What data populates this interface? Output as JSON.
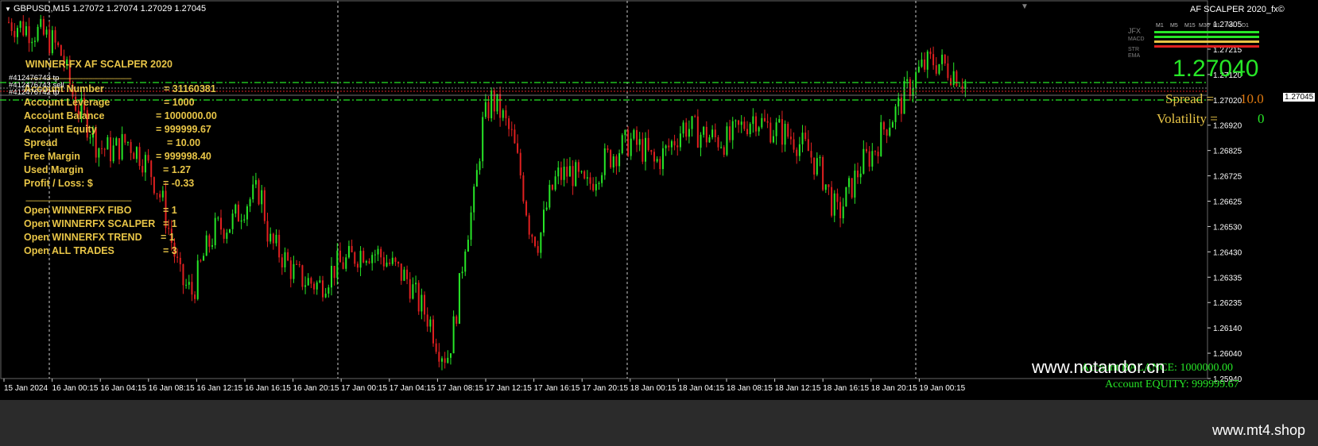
{
  "header": {
    "symbol_line": "GBPUSD,M15  1.27072 1.27074 1.27029 1.27045",
    "indicator_title": "AF SCALPER  2020_fx©"
  },
  "colors": {
    "background": "#000000",
    "bull": "#27e627",
    "bear": "#e02020",
    "panel_text": "#e8c547",
    "green_text": "#27e627",
    "spread_value": "#e07a10"
  },
  "panel": {
    "title": "WINNER-FX    AF SCALPER   2020",
    "separator": "---------------------------------------------------------",
    "rows": [
      {
        "label": "Account Number",
        "value": "= 31160381"
      },
      {
        "label": "Account Leverage",
        "value": "= 1000"
      },
      {
        "label": "Account Balance",
        "value": "= 1000000.00"
      },
      {
        "label": "Account Equity",
        "value": "= 999999.67"
      },
      {
        "label": "Spread",
        "value": "= 10.00"
      },
      {
        "label": "Free Margin",
        "value": "= 999998.40"
      },
      {
        "label": "Used Margin",
        "value": "= 1.27"
      },
      {
        "label": "Profit / Loss: $",
        "value": "= -0.33"
      }
    ],
    "open_rows": [
      {
        "label": "Open WINNERFX FIBO",
        "value": "= 1"
      },
      {
        "label": "Open WINNERFX SCALPER",
        "value": "= 1"
      },
      {
        "label": "Open WINNERFX TREND",
        "value": "= 1"
      },
      {
        "label": "Open ALL TRADES",
        "value": "= 3"
      }
    ]
  },
  "orders": {
    "labels": [
      "#412476743 tp",
      "#412476743 sell",
      "#412476742 tp"
    ]
  },
  "right_panel": {
    "price": "1.27040",
    "spread_label": "Spread =",
    "spread_value": "10.0",
    "volatility_label": "Volatility =",
    "volatility_value": "0",
    "timeframes": [
      "M1",
      "M5",
      "M15",
      "M30",
      "H1",
      "H4",
      "D1"
    ],
    "indicators": [
      "JFX",
      "MACD",
      "STR",
      "EMA"
    ]
  },
  "account_footer": {
    "balance_label": "Account BALANCE:",
    "balance_value": "1000000.00",
    "equity_label": "Account EQUITY:",
    "equity_value": "999999.67"
  },
  "watermarks": {
    "chart": "www.notandor.cn",
    "site": "www.mt4.shop"
  },
  "current_price_tag": "1.27045",
  "chart_data": {
    "type": "candlestick",
    "symbol": "GBPUSD",
    "timeframe": "M15",
    "y_ticks": [
      "1.27305",
      "1.27215",
      "1.27120",
      "1.27020",
      "1.26920",
      "1.26825",
      "1.26725",
      "1.26625",
      "1.26530",
      "1.26430",
      "1.26335",
      "1.26235",
      "1.26140",
      "1.26040",
      "1.25940"
    ],
    "x_ticks": [
      "15 Jan 2024",
      "16 Jan 00:15",
      "16 Jan 04:15",
      "16 Jan 08:15",
      "16 Jan 12:15",
      "16 Jan 16:15",
      "16 Jan 20:15",
      "17 Jan 00:15",
      "17 Jan 04:15",
      "17 Jan 08:15",
      "17 Jan 12:15",
      "17 Jan 16:15",
      "17 Jan 20:15",
      "18 Jan 00:15",
      "18 Jan 04:15",
      "18 Jan 08:15",
      "18 Jan 12:15",
      "18 Jan 16:15",
      "18 Jan 20:15",
      "19 Jan 00:15"
    ],
    "ylim": [
      1.2592,
      1.2733
    ],
    "path": [
      [
        0,
        1.273
      ],
      [
        5,
        1.2728
      ],
      [
        10,
        1.2726
      ],
      [
        15,
        1.2722
      ],
      [
        18,
        1.2717
      ],
      [
        22,
        1.27
      ],
      [
        27,
        1.269
      ],
      [
        30,
        1.2682
      ],
      [
        35,
        1.268
      ],
      [
        40,
        1.2684
      ],
      [
        45,
        1.2678
      ],
      [
        48,
        1.2672
      ],
      [
        52,
        1.266
      ],
      [
        55,
        1.2645
      ],
      [
        58,
        1.263
      ],
      [
        62,
        1.2625
      ],
      [
        66,
        1.264
      ],
      [
        70,
        1.265
      ],
      [
        75,
        1.2652
      ],
      [
        80,
        1.266
      ],
      [
        85,
        1.2665
      ],
      [
        88,
        1.2645
      ],
      [
        92,
        1.264
      ],
      [
        97,
        1.2632
      ],
      [
        100,
        1.263
      ],
      [
        105,
        1.2628
      ],
      [
        110,
        1.2635
      ],
      [
        115,
        1.2638
      ],
      [
        120,
        1.2642
      ],
      [
        125,
        1.264
      ],
      [
        130,
        1.2635
      ],
      [
        135,
        1.263
      ],
      [
        138,
        1.2622
      ],
      [
        142,
        1.2615
      ],
      [
        145,
        1.2605
      ],
      [
        148,
        1.26
      ],
      [
        150,
        1.261
      ],
      [
        152,
        1.2625
      ],
      [
        154,
        1.2645
      ],
      [
        157,
        1.266
      ],
      [
        160,
        1.269
      ],
      [
        163,
        1.27
      ],
      [
        166,
        1.2695
      ],
      [
        170,
        1.2685
      ],
      [
        173,
        1.267
      ],
      [
        176,
        1.265
      ],
      [
        179,
        1.2645
      ],
      [
        182,
        1.266
      ],
      [
        185,
        1.267
      ],
      [
        190,
        1.2672
      ],
      [
        195,
        1.2665
      ],
      [
        200,
        1.2675
      ],
      [
        205,
        1.268
      ],
      [
        210,
        1.2684
      ],
      [
        215,
        1.268
      ],
      [
        218,
        1.2675
      ],
      [
        222,
        1.268
      ],
      [
        228,
        1.269
      ],
      [
        233,
        1.2687
      ],
      [
        238,
        1.2685
      ],
      [
        243,
        1.2684
      ],
      [
        248,
        1.269
      ],
      [
        252,
        1.2694
      ],
      [
        255,
        1.269
      ],
      [
        260,
        1.2688
      ],
      [
        265,
        1.2685
      ],
      [
        270,
        1.268
      ],
      [
        275,
        1.267
      ],
      [
        278,
        1.266
      ],
      [
        280,
        1.2655
      ],
      [
        284,
        1.2665
      ],
      [
        288,
        1.2675
      ],
      [
        292,
        1.268
      ],
      [
        296,
        1.269
      ],
      [
        300,
        1.2696
      ],
      [
        304,
        1.2705
      ],
      [
        308,
        1.2712
      ],
      [
        312,
        1.2715
      ],
      [
        316,
        1.2713
      ],
      [
        320,
        1.271
      ],
      [
        324,
        1.2706
      ]
    ]
  }
}
